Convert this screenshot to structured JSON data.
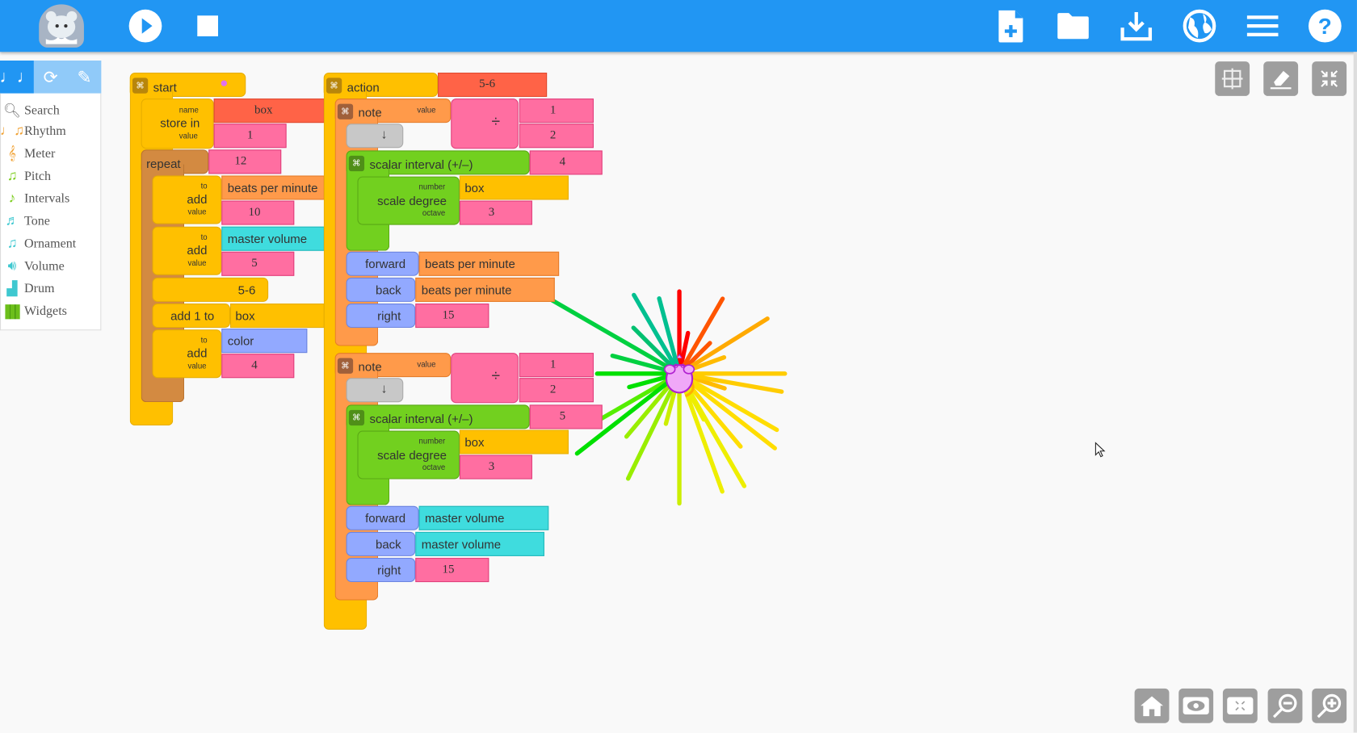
{
  "toolbar": {
    "logo": "mouse-logo",
    "left_buttons": [
      {
        "name": "play-button",
        "icon": "play-icon"
      },
      {
        "name": "stop-button",
        "icon": "stop-icon"
      }
    ],
    "right_buttons": [
      {
        "name": "new-project-button",
        "icon": "new-file-icon"
      },
      {
        "name": "load-project-button",
        "icon": "folder-icon"
      },
      {
        "name": "save-project-button",
        "icon": "download-icon"
      },
      {
        "name": "language-button",
        "icon": "globe-icon"
      },
      {
        "name": "menu-button",
        "icon": "hamburger-icon"
      },
      {
        "name": "help-button",
        "icon": "help-icon"
      }
    ]
  },
  "palette": {
    "tabs": [
      {
        "name": "music-tab",
        "glyph": "♩♩"
      },
      {
        "name": "flow-tab",
        "glyph": "⟳"
      },
      {
        "name": "art-tab",
        "glyph": "✎"
      }
    ],
    "items": [
      {
        "label": "Search",
        "color": "#777777"
      },
      {
        "label": "Rhythm",
        "color": "#f0a030"
      },
      {
        "label": "Meter",
        "color": "#f0a030"
      },
      {
        "label": "Pitch",
        "color": "#7ccd1e"
      },
      {
        "label": "Intervals",
        "color": "#7ccd1e"
      },
      {
        "label": "Tone",
        "color": "#3ec8d0"
      },
      {
        "label": "Ornament",
        "color": "#3ec8d0"
      },
      {
        "label": "Volume",
        "color": "#3ec8d0"
      },
      {
        "label": "Drum",
        "color": "#3ec8d0"
      },
      {
        "label": "Widgets",
        "color": "#6cbf1a"
      }
    ]
  },
  "start_stack": {
    "start_label": "start",
    "store_in": {
      "label": "store in",
      "name_lbl": "name",
      "value_lbl": "value",
      "name": "box",
      "value": "1"
    },
    "repeat": {
      "label": "repeat",
      "count": "12"
    },
    "add1": {
      "label": "add",
      "to_lbl": "to",
      "value_lbl": "value",
      "to": "beats per minute",
      "value": "10"
    },
    "add2": {
      "label": "add",
      "to_lbl": "to",
      "value_lbl": "value",
      "to": "master volume",
      "value": "5"
    },
    "action_call": "5-6",
    "add_one": {
      "label": "add 1 to",
      "target": "box"
    },
    "add3": {
      "label": "add",
      "to_lbl": "to",
      "value_lbl": "value",
      "to": "color",
      "value": "4"
    }
  },
  "action_stack": {
    "action_label": "action",
    "action_name": "5-6",
    "notes": [
      {
        "note_label": "note",
        "value_lbl": "value",
        "numerator": "1",
        "denominator": "2",
        "divide_glyph": "÷",
        "arrow": "↓",
        "interval_label": "scalar interval (+/–)",
        "interval": "4",
        "scale_degree_label": "scale degree",
        "number_lbl": "number",
        "octave_lbl": "octave",
        "number": "box",
        "octave": "3",
        "forward_label": "forward",
        "forward_arg": "beats per minute",
        "back_label": "back",
        "back_arg": "beats per minute",
        "right_label": "right",
        "right_arg": "15"
      },
      {
        "note_label": "note",
        "value_lbl": "value",
        "numerator": "1",
        "denominator": "2",
        "divide_glyph": "÷",
        "arrow": "↓",
        "interval_label": "scalar interval (+/–)",
        "interval": "5",
        "scale_degree_label": "scale degree",
        "number_lbl": "number",
        "octave_lbl": "octave",
        "number": "box",
        "octave": "3",
        "forward_label": "forward",
        "forward_arg": "master volume",
        "back_label": "back",
        "back_arg": "master volume",
        "right_label": "right",
        "right_arg": "15"
      }
    ]
  },
  "canvas": {
    "turtle": "mouse-turtle",
    "ray_colors": [
      "#ff0000",
      "#ff5500",
      "#ff8800",
      "#ffaa00",
      "#ffbb00",
      "#ffcc00",
      "#ffdd00",
      "#eeee00",
      "#ccee00",
      "#99ee00",
      "#55ee00",
      "#00e000",
      "#00d040",
      "#00c070",
      "#00c090"
    ]
  },
  "canvas_controls": [
    {
      "name": "grid-button",
      "icon": "grid-icon"
    },
    {
      "name": "clear-button",
      "icon": "eraser-icon"
    },
    {
      "name": "collapse-button",
      "icon": "collapse-icon"
    }
  ],
  "view_controls": [
    {
      "name": "home-button",
      "icon": "home-icon"
    },
    {
      "name": "hide-blocks-button",
      "icon": "eye-icon"
    },
    {
      "name": "collapse-blocks-button",
      "icon": "expand-icon"
    },
    {
      "name": "zoom-out-button",
      "icon": "zoom-out-icon"
    },
    {
      "name": "zoom-in-button",
      "icon": "zoom-in-icon"
    }
  ]
}
